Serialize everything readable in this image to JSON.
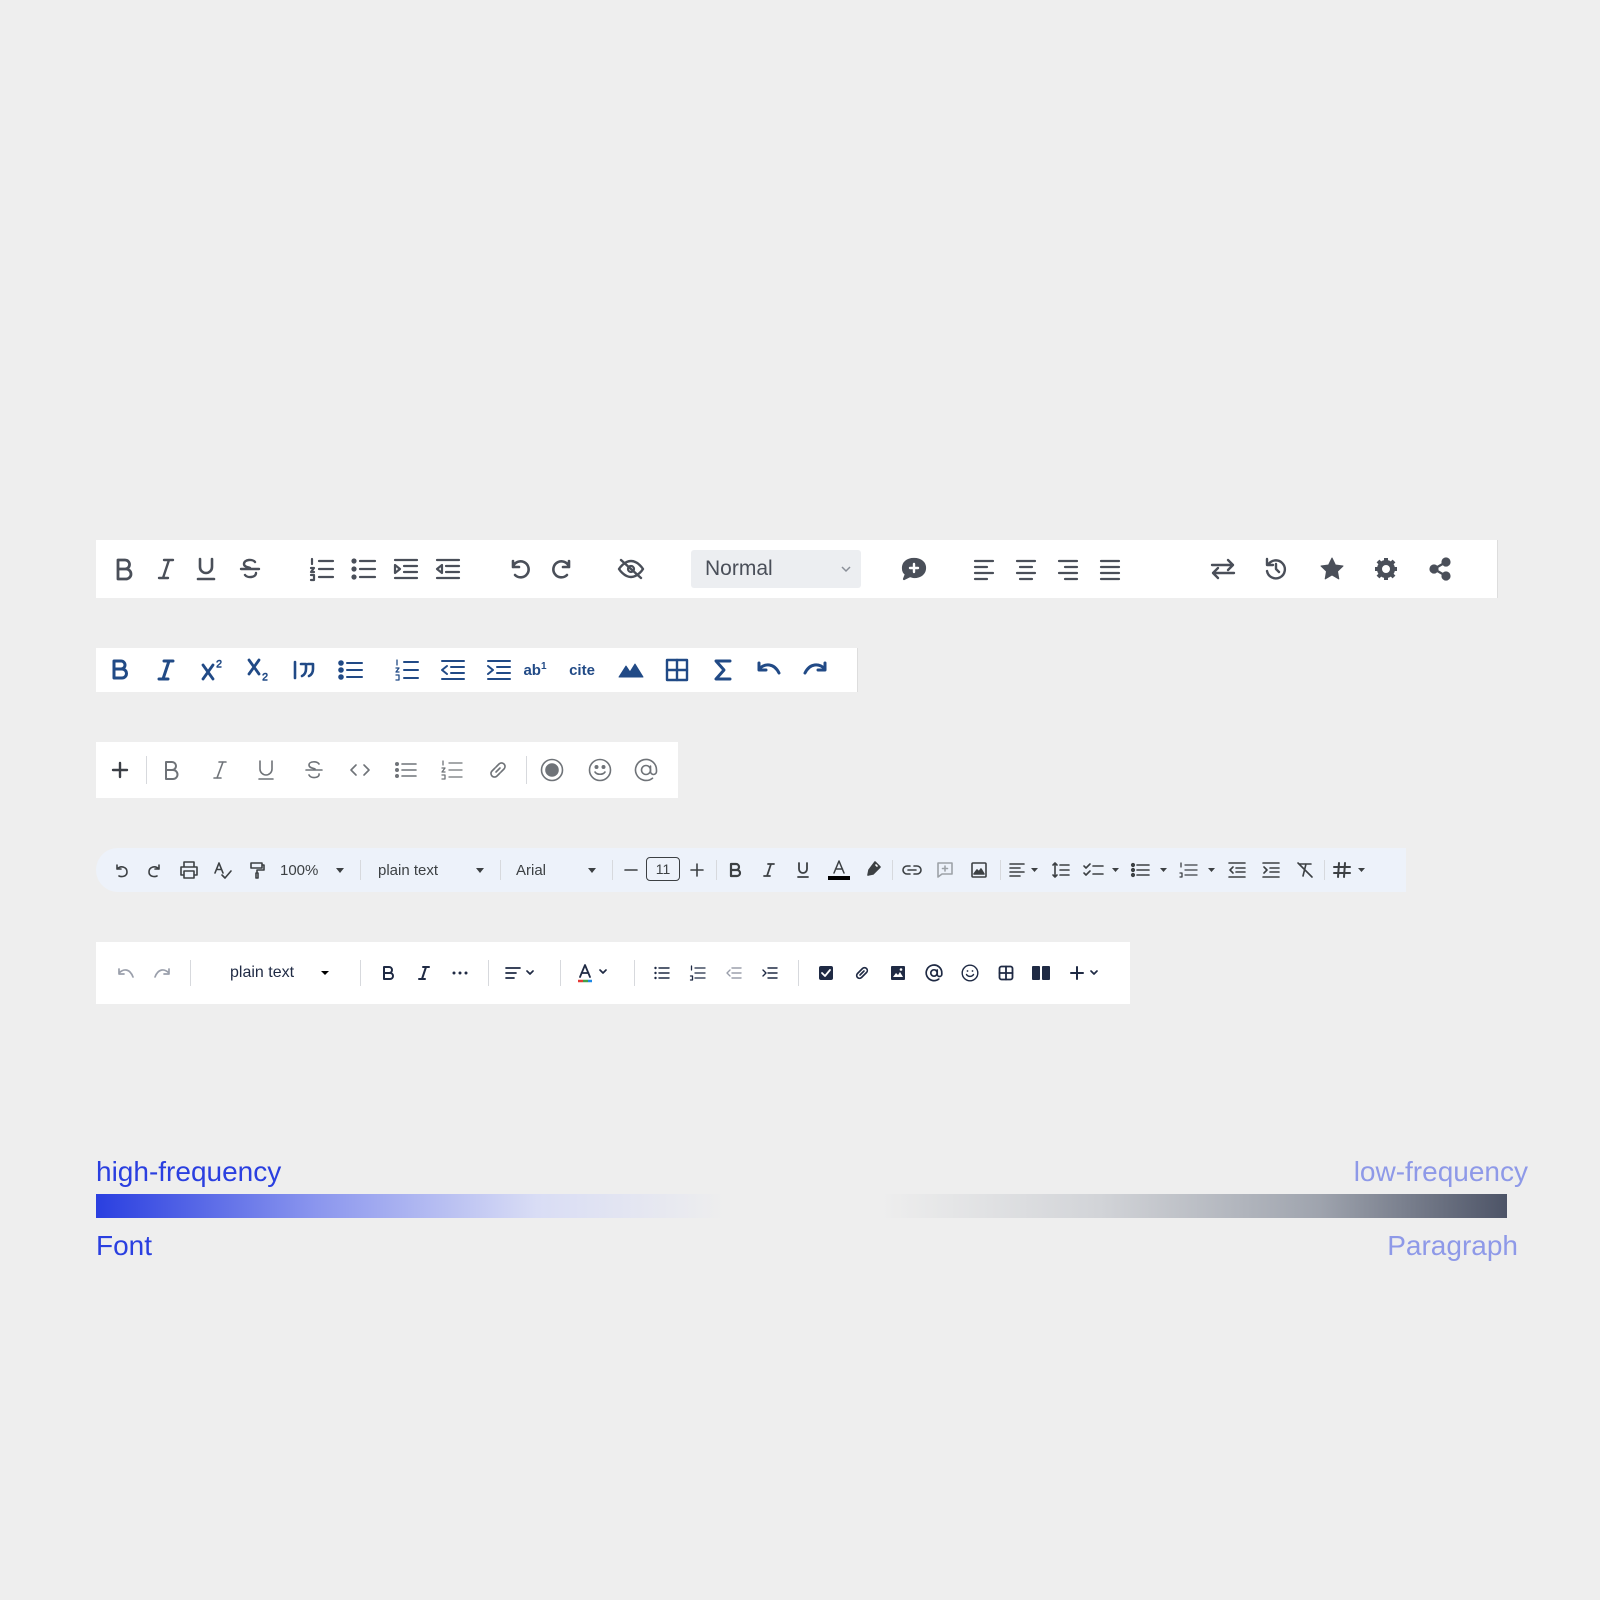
{
  "toolbar1": {
    "style_select": "Normal",
    "icons": [
      "bold-icon",
      "italic-icon",
      "underline-icon",
      "strikethrough-icon",
      "ordered-list-icon",
      "bullet-list-icon",
      "indent-icon",
      "outdent-icon",
      "undo-icon",
      "redo-icon",
      "hide-icon",
      "comment-icon",
      "align-left-icon",
      "align-center-icon",
      "align-right-icon",
      "justify-icon",
      "swap-icon",
      "history-icon",
      "star-icon",
      "gear-icon",
      "share-icon"
    ]
  },
  "toolbar2": {
    "superscript_label": "ab",
    "superscript_num": "1",
    "cite_label": "cite",
    "icons": [
      "bold-icon",
      "italic-icon",
      "superscript-icon",
      "subscript-icon",
      "blockquote-icon",
      "bullet-list-icon",
      "numbered-list-icon",
      "outdent-icon",
      "indent-icon",
      "footnote-icon",
      "cite-icon",
      "image-icon",
      "table-icon",
      "sigma-icon",
      "undo-icon",
      "redo-icon"
    ]
  },
  "toolbar3": {
    "icons": [
      "plus-icon",
      "bold-icon",
      "italic-icon",
      "underline-icon",
      "strikethrough-icon",
      "code-icon",
      "bullet-list-icon",
      "numbered-list-icon",
      "link-icon",
      "record-icon",
      "emoji-icon",
      "at-icon"
    ]
  },
  "toolbar4": {
    "zoom": "100%",
    "style": "plain text",
    "font": "Arial",
    "font_size": "11",
    "text_color": "#000000",
    "icons": [
      "undo-icon",
      "redo-icon",
      "print-icon",
      "spellcheck-icon",
      "paint-format-icon",
      "minus-icon",
      "plus-icon",
      "bold-icon",
      "italic-icon",
      "underline-icon",
      "text-color-icon",
      "highlight-icon",
      "link-icon",
      "add-comment-icon",
      "image-icon",
      "align-icon",
      "line-spacing-icon",
      "checklist-icon",
      "bullet-list-icon",
      "numbered-list-icon",
      "decrease-indent-icon",
      "increase-indent-icon",
      "clear-format-icon",
      "hash-icon"
    ]
  },
  "toolbar5": {
    "style": "plain text",
    "icons": [
      "undo-icon",
      "redo-icon",
      "bold-icon",
      "italic-icon",
      "more-icon",
      "align-icon",
      "text-color-icon",
      "bullet-list-icon",
      "numbered-list-icon",
      "outdent-icon",
      "indent-icon",
      "checkbox-icon",
      "link-icon",
      "image-icon",
      "at-icon",
      "emoji-icon",
      "table-icon",
      "columns-icon",
      "plus-icon"
    ]
  },
  "legend": {
    "high": "high-frequency",
    "low": "low-frequency",
    "font": "Font",
    "paragraph": "Paragraph",
    "high_color": "#2a3fe0",
    "low_color": "#8e99e8",
    "dark_color": "#4d5467"
  }
}
